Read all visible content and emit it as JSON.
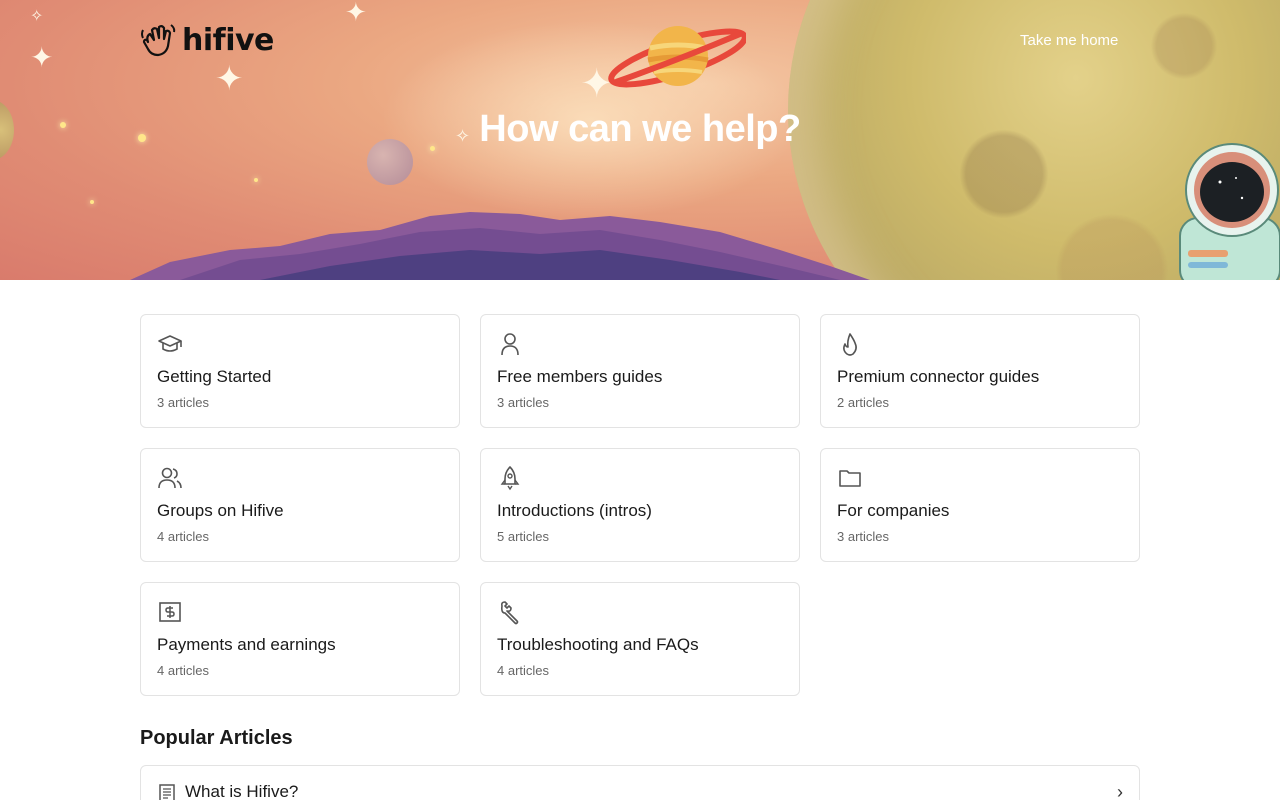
{
  "header": {
    "logo_text": "hifive",
    "home_link": "Take me home",
    "hero_title": "How can we help?"
  },
  "categories": [
    {
      "title": "Getting Started",
      "count": "3 articles",
      "icon": "graduation-cap-icon"
    },
    {
      "title": "Free members guides",
      "count": "3 articles",
      "icon": "user-icon"
    },
    {
      "title": "Premium connector guides",
      "count": "2 articles",
      "icon": "flame-icon"
    },
    {
      "title": "Groups on Hifive",
      "count": "4 articles",
      "icon": "users-icon"
    },
    {
      "title": "Introductions (intros)",
      "count": "5 articles",
      "icon": "rocket-icon"
    },
    {
      "title": "For companies",
      "count": "3 articles",
      "icon": "folder-icon"
    },
    {
      "title": "Payments and earnings",
      "count": "4 articles",
      "icon": "dollar-receipt-icon"
    },
    {
      "title": "Troubleshooting and FAQs",
      "count": "4 articles",
      "icon": "wrench-icon"
    }
  ],
  "popular": {
    "title": "Popular Articles",
    "articles": [
      {
        "title": "What is Hifive?"
      }
    ]
  },
  "colors": {
    "hero_text": "#ffffff",
    "card_border": "#e3e3e3",
    "muted_text": "#666666"
  }
}
